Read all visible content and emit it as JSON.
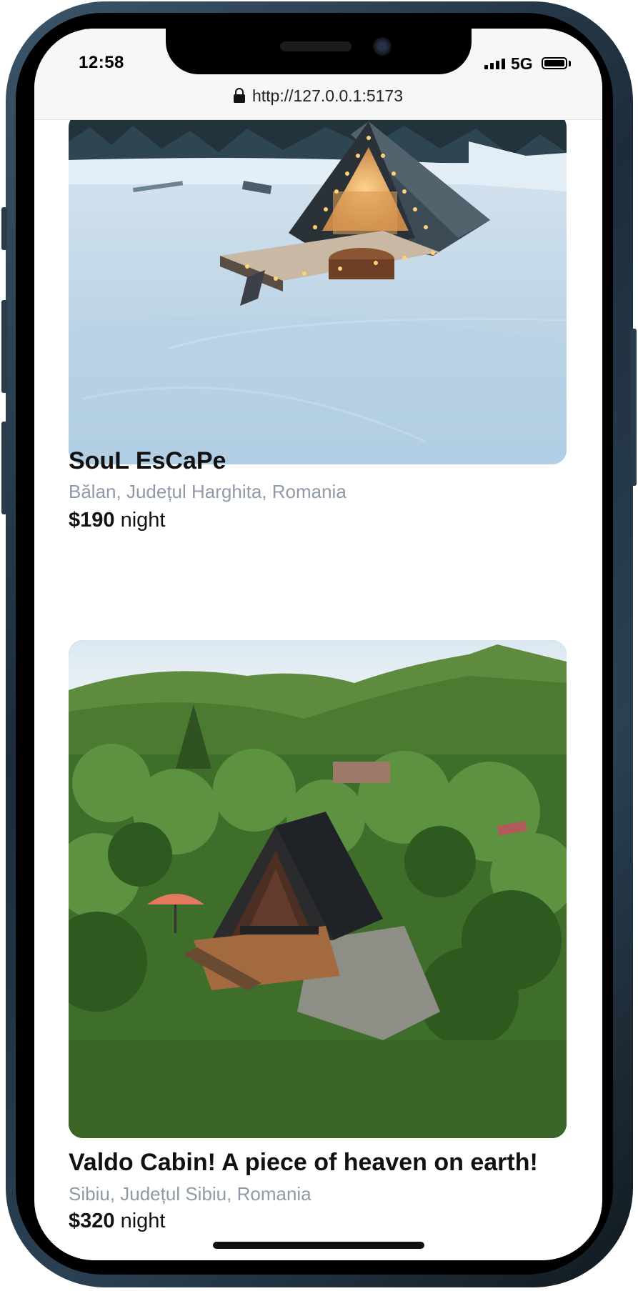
{
  "status_bar": {
    "time": "12:58",
    "network": "5G"
  },
  "browser": {
    "url": "http://127.0.0.1:5173"
  },
  "listings": [
    {
      "title": "SouL EsCaPe",
      "location": "Bălan, Județul Harghita, Romania",
      "price": "$190",
      "price_unit": "night"
    },
    {
      "title": "Valdo Cabin! A piece of heaven on earth!",
      "location": "Sibiu, Județul Sibiu, Romania",
      "price": "$320",
      "price_unit": "night"
    }
  ]
}
